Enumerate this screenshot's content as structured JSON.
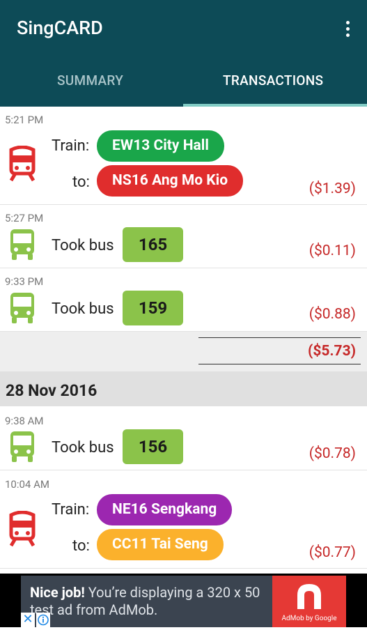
{
  "app": {
    "title": "SingCARD"
  },
  "tabs": [
    {
      "label": "SUMMARY"
    },
    {
      "label": "TRANSACTIONS"
    }
  ],
  "transactions": [
    {
      "time": "5:21 PM",
      "train_label": "Train:",
      "to_label": "to:",
      "from": "EW13 City Hall",
      "from_color": "#1aa64a",
      "to": "NS16 Ang Mo Kio",
      "to_color": "#e02d2d",
      "amount": "($1.39)"
    },
    {
      "time": "5:27 PM",
      "bus_label": "Took bus",
      "bus": "165",
      "amount": "($0.11)"
    },
    {
      "time": "9:33 PM",
      "bus_label": "Took bus",
      "bus": "159",
      "amount": "($0.88)"
    },
    {
      "time": "9:38 AM",
      "bus_label": "Took bus",
      "bus": "156",
      "amount": "($0.78)"
    },
    {
      "time": "10:04 AM",
      "train_label": "Train:",
      "to_label": "to:",
      "from": "NE16 Sengkang",
      "from_color": "#9c27b0",
      "to": "CC11 Tai Seng",
      "to_color": "#fbb12c",
      "amount": "($0.77)"
    }
  ],
  "day_total": "($5.73)",
  "date_header": "28 Nov 2016",
  "ad": {
    "bold": "Nice job!",
    "text": " You’re displaying a 320 x 50 test ad from AdMob.",
    "by": "AdMob by Google",
    "close": "✕"
  },
  "colors": {
    "appbar": "#0d4b57",
    "amount": "#c62828",
    "bus_green": "#8bc34a",
    "train_red": "#e02d2d"
  }
}
